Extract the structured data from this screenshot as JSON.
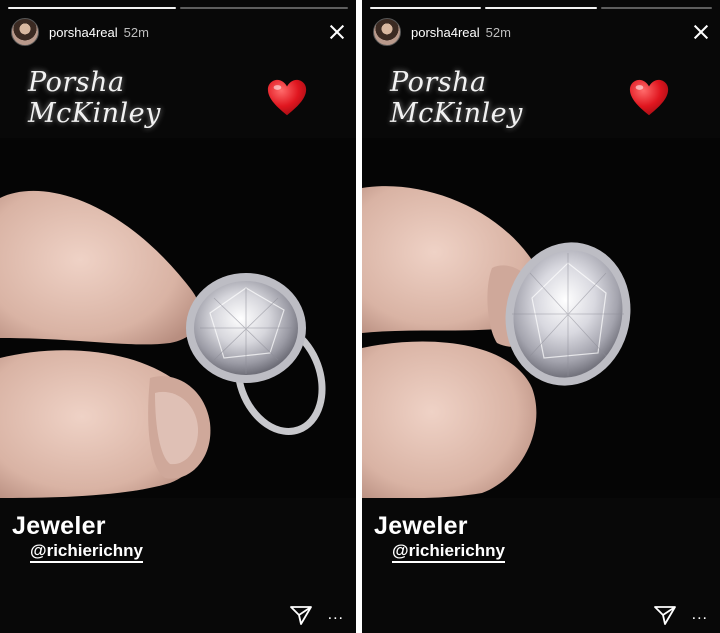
{
  "stories": [
    {
      "username": "porsha4real",
      "time": "52m",
      "script_caption": "Porsha McKinley",
      "caption_title": "Jeweler",
      "caption_handle": "@richierichny",
      "more_label": "..."
    },
    {
      "username": "porsha4real",
      "time": "52m",
      "script_caption": "Porsha McKinley",
      "caption_title": "Jeweler",
      "caption_handle": "@richierichny",
      "more_label": "..."
    }
  ],
  "icons": {
    "close": "close-icon",
    "send": "send-icon",
    "heart": "red-heart-emoji"
  },
  "colors": {
    "background": "#080808",
    "text": "#ffffff",
    "heart": "#e0161f"
  }
}
